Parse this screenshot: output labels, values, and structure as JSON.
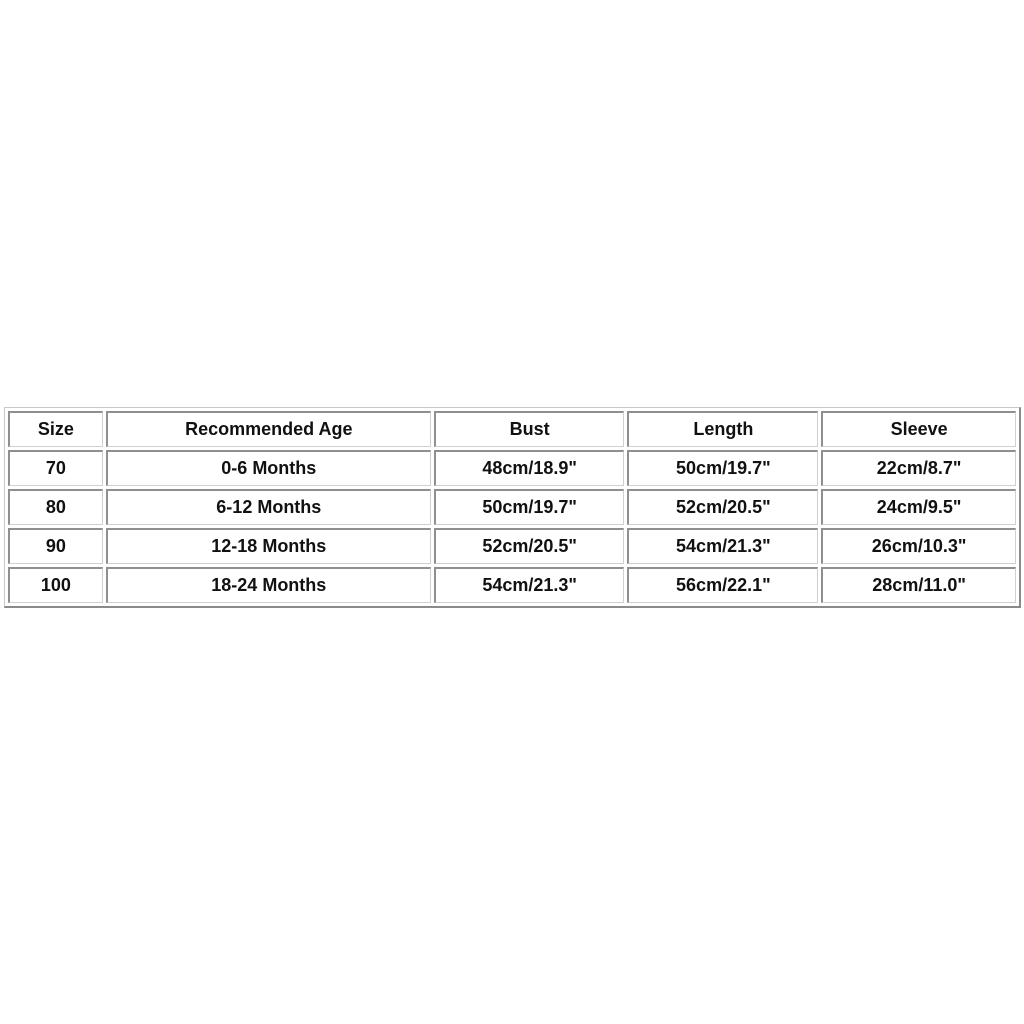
{
  "size_chart": {
    "headers": [
      "Size",
      "Recommended Age",
      "Bust",
      "Length",
      "Sleeve"
    ],
    "rows": [
      [
        "70",
        "0-6 Months",
        "48cm/18.9\"",
        "50cm/19.7\"",
        "22cm/8.7\""
      ],
      [
        "80",
        "6-12 Months",
        "50cm/19.7\"",
        "52cm/20.5\"",
        "24cm/9.5\""
      ],
      [
        "90",
        "12-18 Months",
        "52cm/20.5\"",
        "54cm/21.3\"",
        "26cm/10.3\""
      ],
      [
        "100",
        "18-24 Months",
        "54cm/21.3\"",
        "56cm/22.1\"",
        "28cm/11.0\""
      ]
    ]
  }
}
